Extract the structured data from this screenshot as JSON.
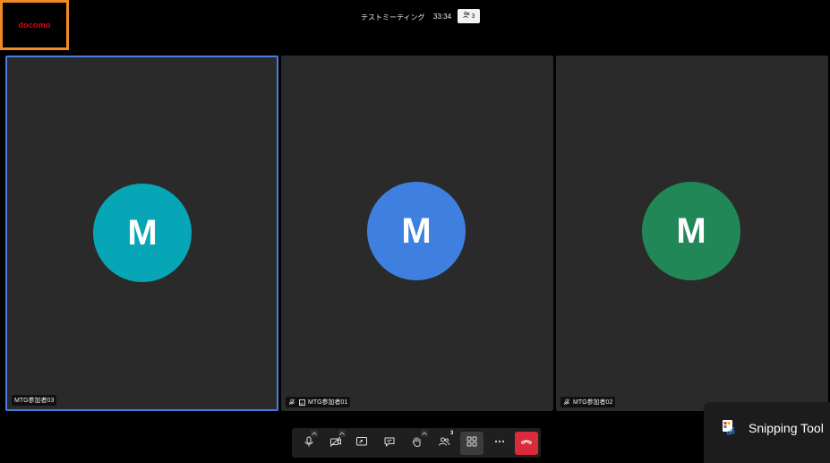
{
  "brand": {
    "logo_text": "docomo",
    "logo_color": "#e60012",
    "highlight_border_color": "#f08a24"
  },
  "meeting": {
    "title": "テストミーティング",
    "timer": "33:34",
    "participant_count": "3"
  },
  "tiles": [
    {
      "initial": "M",
      "name": "MTG参加者03",
      "avatar_color": "#06a6b6",
      "active": true
    },
    {
      "initial": "M",
      "name": "MTG参加者01",
      "avatar_color": "#3f7fe0",
      "active": false
    },
    {
      "initial": "M",
      "name": "MTG参加者02",
      "avatar_color": "#228756",
      "active": false
    }
  ],
  "toolbar": {
    "buttons": [
      {
        "icon": "microphone-icon"
      },
      {
        "icon": "camera-off-icon"
      },
      {
        "icon": "share-screen-icon"
      },
      {
        "icon": "chat-icon"
      },
      {
        "icon": "raise-hand-icon"
      },
      {
        "icon": "participants-icon",
        "badge": "3"
      },
      {
        "icon": "grid-view-icon",
        "selected": true
      },
      {
        "icon": "more-icon"
      },
      {
        "icon": "end-call-icon",
        "color": "#d92b3a"
      }
    ]
  },
  "snipping_tool": {
    "label": "Snipping Tool"
  }
}
